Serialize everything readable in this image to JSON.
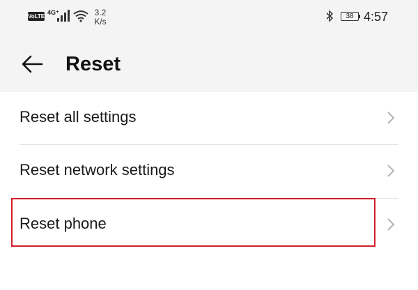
{
  "status_bar": {
    "volte": "VoLTE",
    "network": "4G⁺",
    "speed_value": "3.2",
    "speed_unit": "K/s",
    "battery": "38",
    "time": "4:57"
  },
  "header": {
    "title": "Reset"
  },
  "items": [
    {
      "label": "Reset all settings"
    },
    {
      "label": "Reset network settings"
    },
    {
      "label": "Reset phone"
    }
  ],
  "colors": {
    "highlight": "#d0202a",
    "header_bg": "#f4f4f4"
  }
}
